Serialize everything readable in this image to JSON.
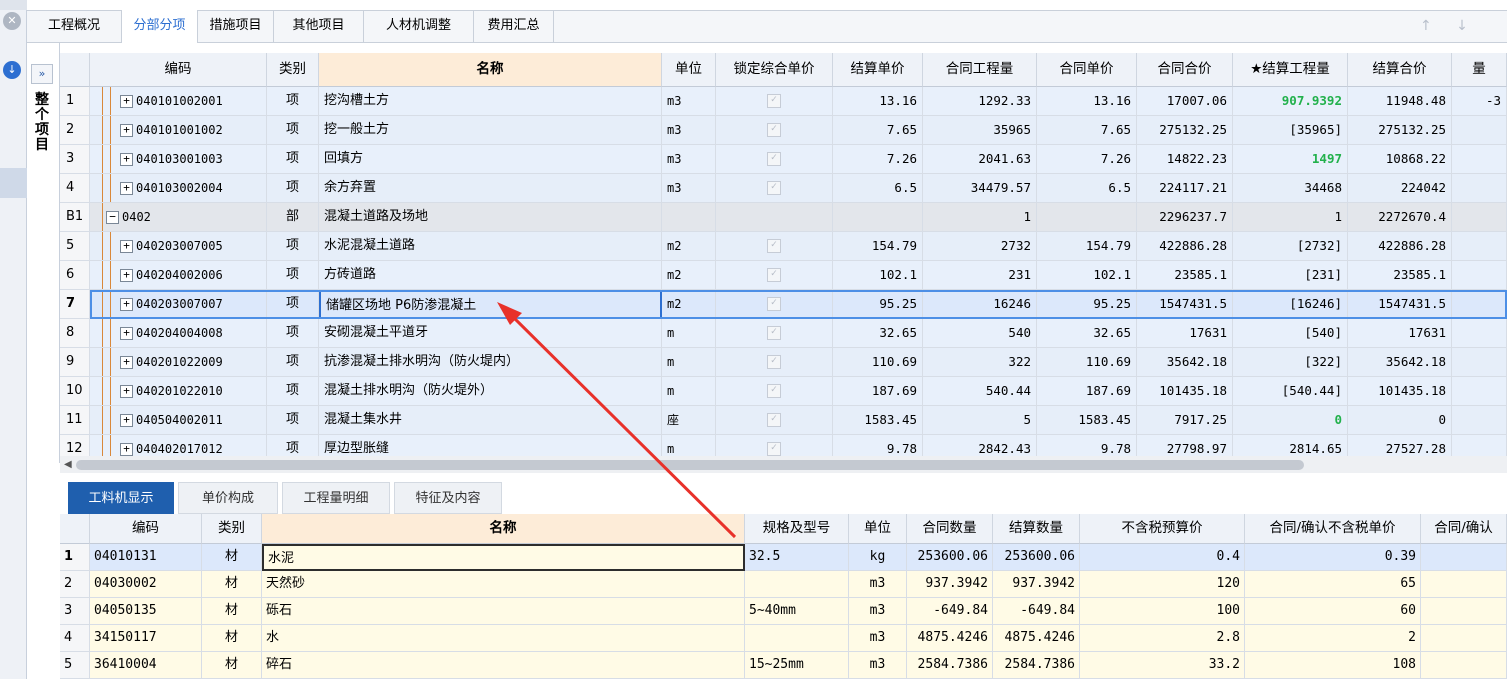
{
  "top_tabs": [
    "工程概况",
    "分部分项",
    "措施项目",
    "其他项目",
    "人材机调整",
    "费用汇总"
  ],
  "active_top_tab": 1,
  "nav_arrows": "↑ ↓ ←",
  "tree": {
    "toggle": "»",
    "label": "整个项目"
  },
  "main_columns": [
    "",
    "编码",
    "类别",
    "名称",
    "单位",
    "锁定综合单价",
    "结算单价",
    "合同工程量",
    "合同单价",
    "合同合价",
    "★结算工程量",
    "结算合价",
    "量"
  ],
  "main_rows": [
    {
      "idx": "1",
      "exp": "+",
      "code": "040101002001",
      "type": "项",
      "name": "挖沟槽土方",
      "unit": "m3",
      "price": "13.16",
      "qty": "1292.33",
      "cprice": "13.16",
      "ctotal": "17007.06",
      "sqty": "907.9392",
      "stotal": "11948.48",
      "extra": "-3",
      "green": true
    },
    {
      "idx": "2",
      "exp": "+",
      "code": "040101001002",
      "type": "项",
      "name": "挖一般土方",
      "unit": "m3",
      "price": "7.65",
      "qty": "35965",
      "cprice": "7.65",
      "ctotal": "275132.25",
      "sqty": "[35965]",
      "stotal": "275132.25",
      "extra": ""
    },
    {
      "idx": "3",
      "exp": "+",
      "code": "040103001003",
      "type": "项",
      "name": "回填方",
      "unit": "m3",
      "price": "7.26",
      "qty": "2041.63",
      "cprice": "7.26",
      "ctotal": "14822.23",
      "sqty": "1497",
      "stotal": "10868.22",
      "extra": "",
      "green": true
    },
    {
      "idx": "4",
      "exp": "+",
      "code": "040103002004",
      "type": "项",
      "name": "余方弃置",
      "unit": "m3",
      "price": "6.5",
      "qty": "34479.57",
      "cprice": "6.5",
      "ctotal": "224117.21",
      "sqty": "34468",
      "stotal": "224042",
      "extra": ""
    },
    {
      "idx": "B1",
      "exp": "−",
      "code": "0402",
      "type": "部",
      "name": "混凝土道路及场地",
      "unit": "",
      "price": "",
      "qty": "1",
      "cprice": "",
      "ctotal": "2296237.7",
      "sqty": "1",
      "stotal": "2272670.4",
      "extra": "",
      "part": true
    },
    {
      "idx": "5",
      "exp": "+",
      "code": "040203007005",
      "type": "项",
      "name": "水泥混凝土道路",
      "unit": "m2",
      "price": "154.79",
      "qty": "2732",
      "cprice": "154.79",
      "ctotal": "422886.28",
      "sqty": "[2732]",
      "stotal": "422886.28",
      "extra": ""
    },
    {
      "idx": "6",
      "exp": "+",
      "code": "040204002006",
      "type": "项",
      "name": "方砖道路",
      "unit": "m2",
      "price": "102.1",
      "qty": "231",
      "cprice": "102.1",
      "ctotal": "23585.1",
      "sqty": "[231]",
      "stotal": "23585.1",
      "extra": ""
    },
    {
      "idx": "7",
      "exp": "+",
      "code": "040203007007",
      "type": "项",
      "name": "储罐区场地 P6防渗混凝土",
      "unit": "m2",
      "price": "95.25",
      "qty": "16246",
      "cprice": "95.25",
      "ctotal": "1547431.5",
      "sqty": "[16246]",
      "stotal": "1547431.5",
      "extra": "",
      "selected": true
    },
    {
      "idx": "8",
      "exp": "+",
      "code": "040204004008",
      "type": "项",
      "name": "安砌混凝土平道牙",
      "unit": "m",
      "price": "32.65",
      "qty": "540",
      "cprice": "32.65",
      "ctotal": "17631",
      "sqty": "[540]",
      "stotal": "17631",
      "extra": ""
    },
    {
      "idx": "9",
      "exp": "+",
      "code": "040201022009",
      "type": "项",
      "name": "抗渗混凝土排水明沟（防火堤内）",
      "unit": "m",
      "price": "110.69",
      "qty": "322",
      "cprice": "110.69",
      "ctotal": "35642.18",
      "sqty": "[322]",
      "stotal": "35642.18",
      "extra": ""
    },
    {
      "idx": "10",
      "exp": "+",
      "code": "040201022010",
      "type": "项",
      "name": "混凝土排水明沟（防火堤外）",
      "unit": "m",
      "price": "187.69",
      "qty": "540.44",
      "cprice": "187.69",
      "ctotal": "101435.18",
      "sqty": "[540.44]",
      "stotal": "101435.18",
      "extra": ""
    },
    {
      "idx": "11",
      "exp": "+",
      "code": "040504002011",
      "type": "项",
      "name": "混凝土集水井",
      "unit": "座",
      "price": "1583.45",
      "qty": "5",
      "cprice": "1583.45",
      "ctotal": "7917.25",
      "sqty": "0",
      "stotal": "0",
      "extra": "",
      "green": true
    },
    {
      "idx": "12",
      "exp": "+",
      "code": "040402017012",
      "type": "项",
      "name": "厚边型胀缝",
      "unit": "m",
      "price": "9.78",
      "qty": "2842.43",
      "cprice": "9.78",
      "ctotal": "27798.97",
      "sqty": "2814.65",
      "stotal": "27527.28",
      "extra": ""
    }
  ],
  "bottom_tabs": [
    "工料机显示",
    "单价构成",
    "工程量明细",
    "特征及内容"
  ],
  "active_bottom_tab": 0,
  "bottom_columns": [
    "",
    "编码",
    "类别",
    "名称",
    "规格及型号",
    "单位",
    "合同数量",
    "结算数量",
    "不含税预算价",
    "合同/确认不含税单价",
    "合同/确认"
  ],
  "bottom_rows": [
    {
      "idx": "1",
      "code": "04010131",
      "type": "材",
      "name": "水泥",
      "spec": "32.5",
      "unit": "kg",
      "cqty": "253600.06",
      "sqty": "253600.06",
      "budget": "0.4",
      "cprice": "0.39",
      "selected": true
    },
    {
      "idx": "2",
      "code": "04030002",
      "type": "材",
      "name": "天然砂",
      "spec": "",
      "unit": "m3",
      "cqty": "937.3942",
      "sqty": "937.3942",
      "budget": "120",
      "cprice": "65"
    },
    {
      "idx": "3",
      "code": "04050135",
      "type": "材",
      "name": "砾石",
      "spec": "5~40mm",
      "unit": "m3",
      "cqty": "-649.84",
      "sqty": "-649.84",
      "budget": "100",
      "cprice": "60"
    },
    {
      "idx": "4",
      "code": "34150117",
      "type": "材",
      "name": "水",
      "spec": "",
      "unit": "m3",
      "cqty": "4875.4246",
      "sqty": "4875.4246",
      "budget": "2.8",
      "cprice": "2"
    },
    {
      "idx": "5",
      "code": "36410004",
      "type": "材",
      "name": "碎石",
      "spec": "15~25mm",
      "unit": "m3",
      "cqty": "2584.7386",
      "sqty": "2584.7386",
      "budget": "33.2",
      "cprice": "108"
    }
  ],
  "colors": {
    "accent": "#2d6fd1",
    "active_bottom_tab": "#1f5fae",
    "name_header": "#fdecd8",
    "annotation_arrow": "#e8312a",
    "positive_green": "#22b14c"
  },
  "icons": {
    "rail_top": "close-circle-icon",
    "rail_second": "download-circle-icon",
    "tree_toggle": "double-chevron-right-icon"
  }
}
